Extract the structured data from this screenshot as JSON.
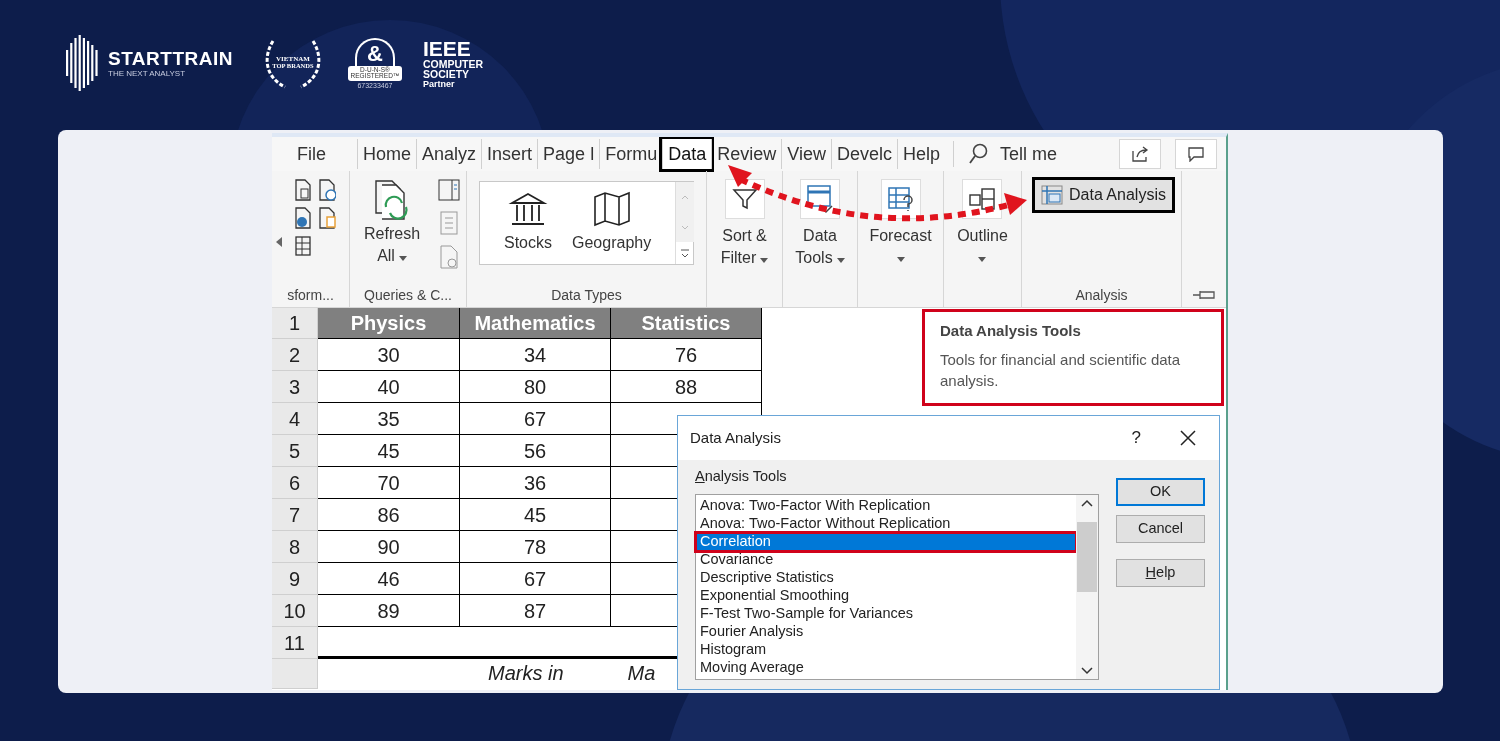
{
  "logos": [
    {
      "kind": "starttrain",
      "name": "STARTTRAIN",
      "tagline": "THE NEXT ANALYST"
    },
    {
      "kind": "award",
      "lines": [
        "VIETNAM",
        "TOP BRANDS"
      ]
    },
    {
      "kind": "duns",
      "symbol": "&",
      "lines": [
        "D-U-N-S®",
        "REGISTERED™"
      ],
      "number": "673233467"
    },
    {
      "kind": "ieee",
      "name": "IEEE",
      "lines": [
        "COMPUTER",
        "SOCIETY"
      ],
      "tag": "Partner"
    }
  ],
  "excel": {
    "tabs": [
      {
        "label": "File",
        "selected": false,
        "highlighted": false
      },
      {
        "label": "Home",
        "selected": false,
        "highlighted": false
      },
      {
        "label": "Analyz",
        "selected": false,
        "highlighted": false
      },
      {
        "label": "Insert",
        "selected": false,
        "highlighted": false
      },
      {
        "label": "Page l",
        "selected": false,
        "highlighted": false
      },
      {
        "label": "Formu",
        "selected": false,
        "highlighted": false
      },
      {
        "label": "Data",
        "selected": true,
        "highlighted": true
      },
      {
        "label": "Review",
        "selected": false,
        "highlighted": false
      },
      {
        "label": "View",
        "selected": false,
        "highlighted": false
      },
      {
        "label": "Develc",
        "selected": false,
        "highlighted": false
      },
      {
        "label": "Help",
        "selected": false,
        "highlighted": false
      }
    ],
    "search": {
      "label": "Tell me"
    },
    "ribbon_groups": [
      {
        "kind": "icon-grid",
        "label": "sform..."
      },
      {
        "kind": "queries",
        "label": "Queries & C...",
        "buttons": [
          {
            "kind": "refresh",
            "lines": [
              "Refresh",
              "All"
            ],
            "dropdown": true
          }
        ]
      },
      {
        "kind": "gallery",
        "label": "Data Types",
        "buttons": [
          {
            "kind": "stocks",
            "lines": [
              "Stocks"
            ]
          },
          {
            "kind": "geography",
            "lines": [
              "Geography"
            ]
          }
        ]
      },
      {
        "kind": "large",
        "buttons": [
          {
            "kind": "filter",
            "lines": [
              "Sort &",
              "Filter"
            ],
            "dropdown": true
          }
        ]
      },
      {
        "kind": "large",
        "buttons": [
          {
            "kind": "data-tools",
            "lines": [
              "Data",
              "Tools"
            ],
            "dropdown": true
          }
        ]
      },
      {
        "kind": "large",
        "buttons": [
          {
            "kind": "forecast",
            "lines": [
              "Forecast"
            ],
            "dropdown": true
          }
        ]
      },
      {
        "kind": "large",
        "buttons": [
          {
            "kind": "outline",
            "lines": [
              "Outline"
            ],
            "dropdown": true
          }
        ]
      },
      {
        "kind": "analysis",
        "label": "Analysis",
        "buttons": [
          {
            "kind": "data-analysis",
            "lines": [
              "Data Analysis"
            ],
            "highlighted": true
          }
        ]
      }
    ],
    "sheet": {
      "header_number": "1",
      "columns": [
        "Physics",
        "Mathematics",
        "Statistics"
      ],
      "rows": [
        {
          "number": "2",
          "cells": [
            "30",
            "34",
            "76"
          ]
        },
        {
          "number": "3",
          "cells": [
            "40",
            "80",
            "88"
          ]
        },
        {
          "number": "4",
          "cells": [
            "35",
            "67"
          ]
        },
        {
          "number": "5",
          "cells": [
            "45",
            "56"
          ]
        },
        {
          "number": "6",
          "cells": [
            "70",
            "36"
          ]
        },
        {
          "number": "7",
          "cells": [
            "86",
            "45"
          ]
        },
        {
          "number": "8",
          "cells": [
            "90",
            "78"
          ]
        },
        {
          "number": "9",
          "cells": [
            "46",
            "67"
          ]
        },
        {
          "number": "10",
          "cells": [
            "89",
            "87"
          ]
        },
        {
          "number": "11"
        }
      ],
      "footer_texts": [
        "Marks in",
        "Ma"
      ]
    },
    "tooltip": {
      "title": "Data Analysis Tools",
      "body": "Tools for financial and scientific data analysis."
    },
    "dialog": {
      "title": "Data Analysis",
      "help": "?",
      "list_label": "Analysis Tools",
      "list_label_mnemonic": true,
      "items": [
        {
          "label": "Anova: Two-Factor With Replication",
          "selected": false,
          "highlighted": false
        },
        {
          "label": "Anova: Two-Factor Without Replication",
          "selected": false,
          "highlighted": false
        },
        {
          "label": "Correlation",
          "selected": true,
          "highlighted": true
        },
        {
          "label": "Covariance",
          "selected": false,
          "highlighted": false
        },
        {
          "label": "Descriptive Statistics",
          "selected": false,
          "highlighted": false
        },
        {
          "label": "Exponential Smoothing",
          "selected": false,
          "highlighted": false
        },
        {
          "label": "F-Test Two-Sample for Variances",
          "selected": false,
          "highlighted": false
        },
        {
          "label": "Fourier Analysis",
          "selected": false,
          "highlighted": false
        },
        {
          "label": "Histogram",
          "selected": false,
          "highlighted": false
        },
        {
          "label": "Moving Average",
          "selected": false,
          "highlighted": false
        }
      ],
      "buttons": [
        {
          "label": "OK",
          "default": true,
          "mnemonic": false
        },
        {
          "label": "Cancel",
          "default": false,
          "mnemonic": false
        },
        {
          "label": "Help",
          "default": false,
          "mnemonic": true
        }
      ]
    }
  }
}
